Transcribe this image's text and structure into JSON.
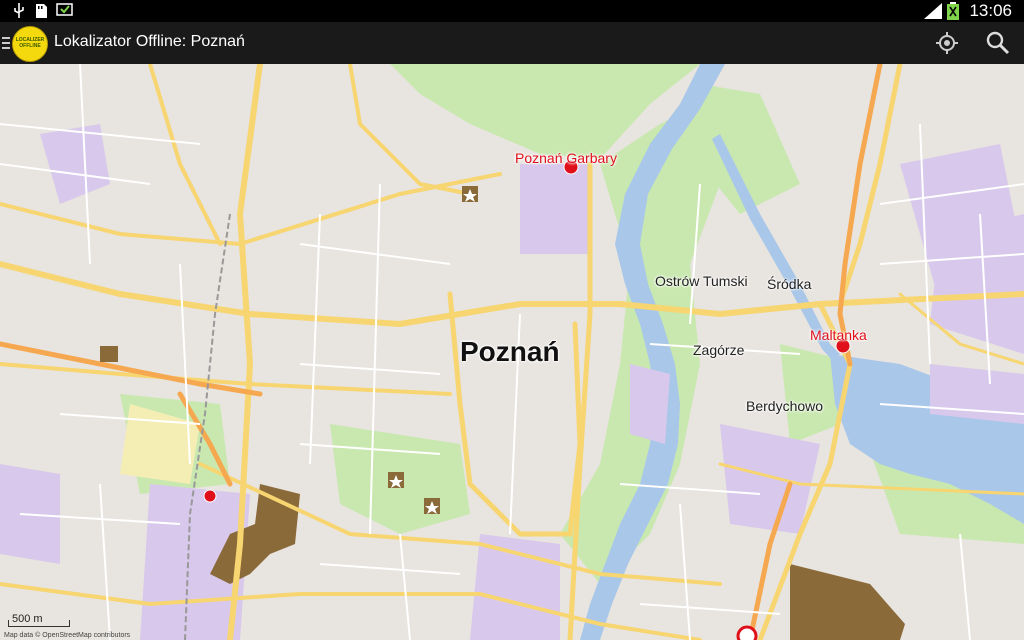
{
  "status_bar": {
    "time": "13:06"
  },
  "action_bar": {
    "app_logo_text": "LOCALIZER OFFLINE",
    "title": "Lokalizator Offline: Poznań"
  },
  "map": {
    "city_label": "Poznań",
    "district_labels": [
      "Ostrów Tumski",
      "Śródka",
      "Zagórze",
      "Berdychowo"
    ],
    "station_labels": [
      "Poznań Garbary",
      "Maltanka"
    ],
    "scale_label": "500 m",
    "attribution": "Map data © OpenStreetMap contributors",
    "colors": {
      "background": "#e8e4df",
      "road_major": "#f7d571",
      "road_orange": "#f5a84f",
      "park": "#c9e8b0",
      "water": "#a9c7e8",
      "building_purple": "#d8c8ec",
      "industrial_brown": "#8b6a3a",
      "station_red": "#e0101a"
    }
  }
}
